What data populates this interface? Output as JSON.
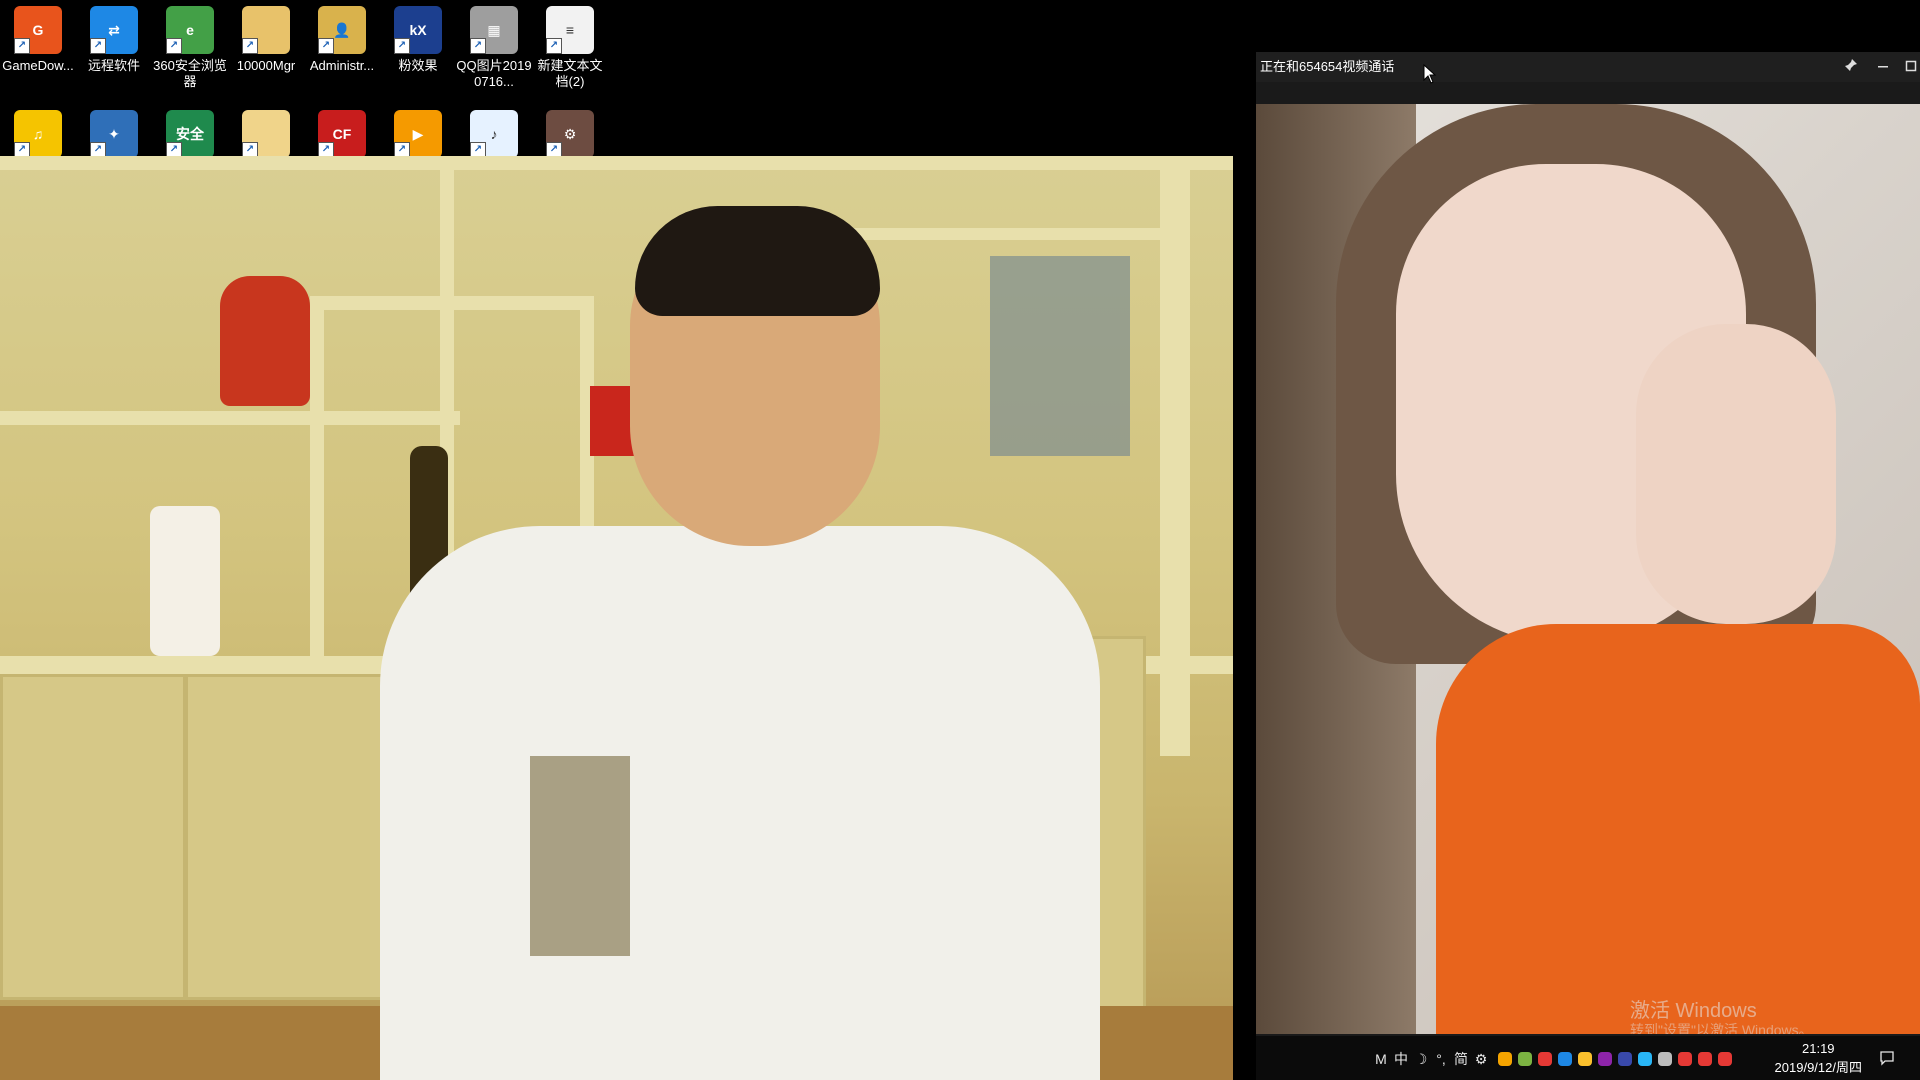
{
  "desktop": {
    "row1": [
      {
        "label": "GameDow...",
        "icon": "gamedownload-icon",
        "color": "#e8541c",
        "glyph": "G"
      },
      {
        "label": "远程软件",
        "icon": "teamviewer-icon",
        "color": "#1e88e5",
        "glyph": "⇄"
      },
      {
        "label": "360安全浏览器",
        "icon": "360-browser-icon",
        "color": "#43a047",
        "glyph": "e"
      },
      {
        "label": "10000Mgr",
        "icon": "folder-icon",
        "color": "#e8c26a",
        "glyph": ""
      },
      {
        "label": "Administr...",
        "icon": "user-folder-icon",
        "color": "#d9b24c",
        "glyph": "👤"
      },
      {
        "label": "粉效果",
        "icon": "kx-icon",
        "color": "#1c3f8f",
        "glyph": "kX"
      },
      {
        "label": "QQ图片20190716...",
        "icon": "qr-image-icon",
        "color": "#9e9e9e",
        "glyph": "▦"
      },
      {
        "label": "新建文本文档(2)",
        "icon": "text-file-icon",
        "color": "#f2f2f2",
        "glyph": "≡"
      }
    ],
    "row2": [
      {
        "label": "",
        "icon": "music-app-icon",
        "color": "#f5c400",
        "glyph": "♫"
      },
      {
        "label": "",
        "icon": "tool-icon",
        "color": "#2f6fb8",
        "glyph": "✦"
      },
      {
        "label": "",
        "icon": "security-shield-icon",
        "color": "#1f8a4d",
        "glyph": "安全"
      },
      {
        "label": "",
        "icon": "folder-icon",
        "color": "#f0d48a",
        "glyph": ""
      },
      {
        "label": "",
        "icon": "crossfire-icon",
        "color": "#c81d1d",
        "glyph": "CF"
      },
      {
        "label": "",
        "icon": "video-player-icon",
        "color": "#f59a00",
        "glyph": "▶"
      },
      {
        "label": "",
        "icon": "mp3-file-icon",
        "color": "#e6f2ff",
        "glyph": "♪"
      },
      {
        "label": "",
        "icon": "installer-icon",
        "color": "#6d4c41",
        "glyph": "⚙"
      }
    ]
  },
  "call_window": {
    "title": "正在和654654视频通话",
    "pin_icon": "pin-icon",
    "min_icon": "minimize-icon",
    "max_icon": "maximize-icon"
  },
  "watermark": {
    "line1": "激活 Windows",
    "line2": "转到\"设置\"以激活 Windows。"
  },
  "taskbar": {
    "tray": [
      "M",
      "中",
      "☽",
      "°,",
      "简",
      "⚙"
    ],
    "clock_time": "21:19",
    "clock_date": "2019/9/12/周四"
  }
}
